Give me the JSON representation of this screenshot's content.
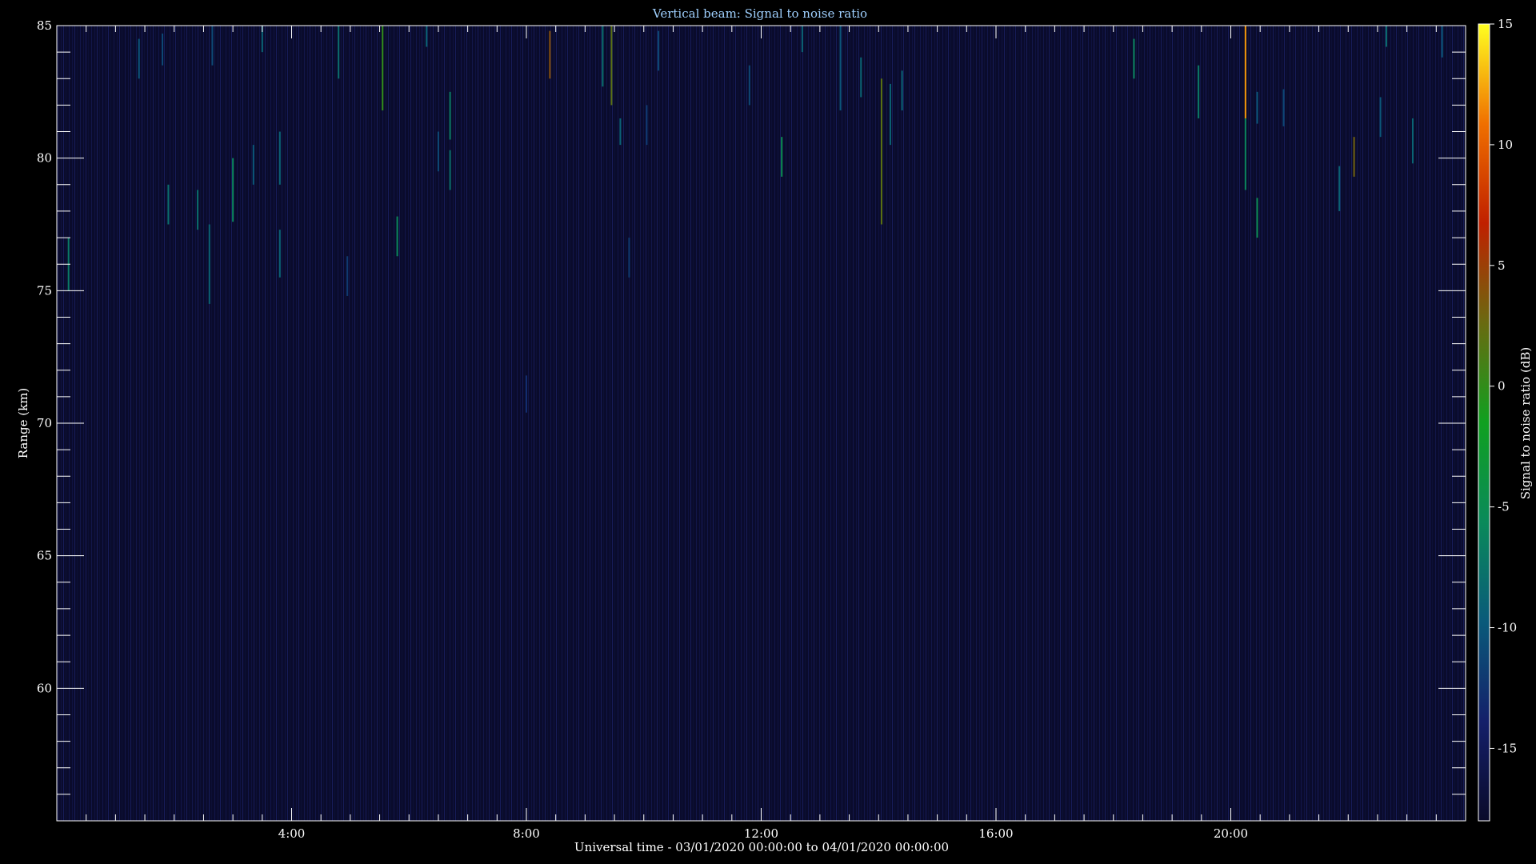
{
  "chart_data": {
    "type": "heatmap",
    "title": "Vertical beam: Signal to noise ratio",
    "xlabel": "Universal time - 03/01/2020 00:00:00 to 04/01/2020 00:00:00",
    "ylabel": "Range (km)",
    "xlim": [
      0,
      24
    ],
    "ylim": [
      55,
      85
    ],
    "x_ticks": [
      {
        "value": 4,
        "label": "4:00"
      },
      {
        "value": 8,
        "label": "8:00"
      },
      {
        "value": 12,
        "label": "12:00"
      },
      {
        "value": 16,
        "label": "16:00"
      },
      {
        "value": 20,
        "label": "20:00"
      }
    ],
    "y_ticks": [
      {
        "value": 60,
        "label": "60"
      },
      {
        "value": 65,
        "label": "65"
      },
      {
        "value": 70,
        "label": "70"
      },
      {
        "value": 75,
        "label": "75"
      },
      {
        "value": 80,
        "label": "80"
      },
      {
        "value": 85,
        "label": "85"
      }
    ],
    "colorbar": {
      "label": "Signal to noise ratio (dB)",
      "range": [
        -18,
        15
      ],
      "ticks": [
        {
          "value": 15,
          "label": "15"
        },
        {
          "value": 10,
          "label": "10"
        },
        {
          "value": 5,
          "label": "5"
        },
        {
          "value": 0,
          "label": "0"
        },
        {
          "value": -5,
          "label": "-5"
        },
        {
          "value": -10,
          "label": "-10"
        },
        {
          "value": -15,
          "label": "-15"
        }
      ],
      "colors": [
        "#0a0a2a",
        "#14206a",
        "#0a5a7a",
        "#0a8a5a",
        "#10a020",
        "#6a6a10",
        "#c02000",
        "#f07000",
        "#ffff20"
      ]
    },
    "background_snr": -17,
    "grid": false,
    "streaks": [
      {
        "t": 0.2,
        "r0": 75.0,
        "r1": 77.0,
        "snr": -7
      },
      {
        "t": 1.4,
        "r0": 83.0,
        "r1": 84.5,
        "snr": -10
      },
      {
        "t": 1.8,
        "r0": 83.5,
        "r1": 84.7,
        "snr": -11
      },
      {
        "t": 1.9,
        "r0": 77.5,
        "r1": 79.0,
        "snr": -8
      },
      {
        "t": 2.4,
        "r0": 77.3,
        "r1": 78.8,
        "snr": -8
      },
      {
        "t": 2.6,
        "r0": 74.5,
        "r1": 77.5,
        "snr": -9
      },
      {
        "t": 2.65,
        "r0": 83.5,
        "r1": 85.0,
        "snr": -11
      },
      {
        "t": 3.0,
        "r0": 77.6,
        "r1": 80.0,
        "snr": -6
      },
      {
        "t": 3.35,
        "r0": 79.0,
        "r1": 80.5,
        "snr": -10
      },
      {
        "t": 3.5,
        "r0": 84.0,
        "r1": 85.0,
        "snr": -9
      },
      {
        "t": 3.8,
        "r0": 79.0,
        "r1": 81.0,
        "snr": -9
      },
      {
        "t": 3.8,
        "r0": 75.5,
        "r1": 77.3,
        "snr": -9
      },
      {
        "t": 4.8,
        "r0": 83.0,
        "r1": 85.0,
        "snr": -8
      },
      {
        "t": 4.95,
        "r0": 74.8,
        "r1": 76.3,
        "snr": -12
      },
      {
        "t": 5.55,
        "r0": 81.8,
        "r1": 85.0,
        "snr": 0
      },
      {
        "t": 5.8,
        "r0": 76.3,
        "r1": 77.8,
        "snr": -6
      },
      {
        "t": 6.3,
        "r0": 84.2,
        "r1": 85.0,
        "snr": -9
      },
      {
        "t": 6.5,
        "r0": 79.5,
        "r1": 81.0,
        "snr": -11
      },
      {
        "t": 6.7,
        "r0": 78.8,
        "r1": 80.3,
        "snr": -8
      },
      {
        "t": 6.7,
        "r0": 80.7,
        "r1": 82.5,
        "snr": -7
      },
      {
        "t": 8.0,
        "r0": 70.4,
        "r1": 71.8,
        "snr": -13
      },
      {
        "t": 8.4,
        "r0": 83.0,
        "r1": 84.8,
        "snr": 4
      },
      {
        "t": 9.3,
        "r0": 82.7,
        "r1": 85.0,
        "snr": -8
      },
      {
        "t": 9.45,
        "r0": 82.0,
        "r1": 85.0,
        "snr": 2
      },
      {
        "t": 9.6,
        "r0": 80.5,
        "r1": 81.5,
        "snr": -9
      },
      {
        "t": 9.75,
        "r0": 75.5,
        "r1": 77.0,
        "snr": -12
      },
      {
        "t": 10.05,
        "r0": 80.5,
        "r1": 82.0,
        "snr": -12
      },
      {
        "t": 10.25,
        "r0": 83.3,
        "r1": 84.8,
        "snr": -11
      },
      {
        "t": 11.8,
        "r0": 82.0,
        "r1": 83.5,
        "snr": -11
      },
      {
        "t": 12.35,
        "r0": 79.3,
        "r1": 80.8,
        "snr": -5
      },
      {
        "t": 12.7,
        "r0": 84.0,
        "r1": 85.0,
        "snr": -9
      },
      {
        "t": 13.35,
        "r0": 81.8,
        "r1": 85.0,
        "snr": -10
      },
      {
        "t": 13.7,
        "r0": 82.3,
        "r1": 83.8,
        "snr": -9
      },
      {
        "t": 14.05,
        "r0": 77.5,
        "r1": 83.0,
        "snr": 2
      },
      {
        "t": 14.2,
        "r0": 80.5,
        "r1": 82.8,
        "snr": -9
      },
      {
        "t": 14.4,
        "r0": 81.8,
        "r1": 83.3,
        "snr": -9
      },
      {
        "t": 18.35,
        "r0": 83.0,
        "r1": 84.5,
        "snr": -6
      },
      {
        "t": 19.45,
        "r0": 81.5,
        "r1": 83.5,
        "snr": -7
      },
      {
        "t": 20.25,
        "r0": 81.5,
        "r1": 85.0,
        "snr": 12
      },
      {
        "t": 20.25,
        "r0": 78.8,
        "r1": 81.5,
        "snr": -6
      },
      {
        "t": 20.45,
        "r0": 81.3,
        "r1": 82.5,
        "snr": -10
      },
      {
        "t": 20.45,
        "r0": 77.0,
        "r1": 78.5,
        "snr": -5
      },
      {
        "t": 20.9,
        "r0": 81.2,
        "r1": 82.6,
        "snr": -11
      },
      {
        "t": 21.85,
        "r0": 78.0,
        "r1": 79.7,
        "snr": -9
      },
      {
        "t": 22.1,
        "r0": 79.3,
        "r1": 80.8,
        "snr": 3
      },
      {
        "t": 22.55,
        "r0": 80.8,
        "r1": 82.3,
        "snr": -10
      },
      {
        "t": 22.65,
        "r0": 84.2,
        "r1": 85.0,
        "snr": -8
      },
      {
        "t": 23.1,
        "r0": 79.8,
        "r1": 81.5,
        "snr": -9
      },
      {
        "t": 23.6,
        "r0": 83.8,
        "r1": 85.0,
        "snr": -10
      }
    ]
  }
}
